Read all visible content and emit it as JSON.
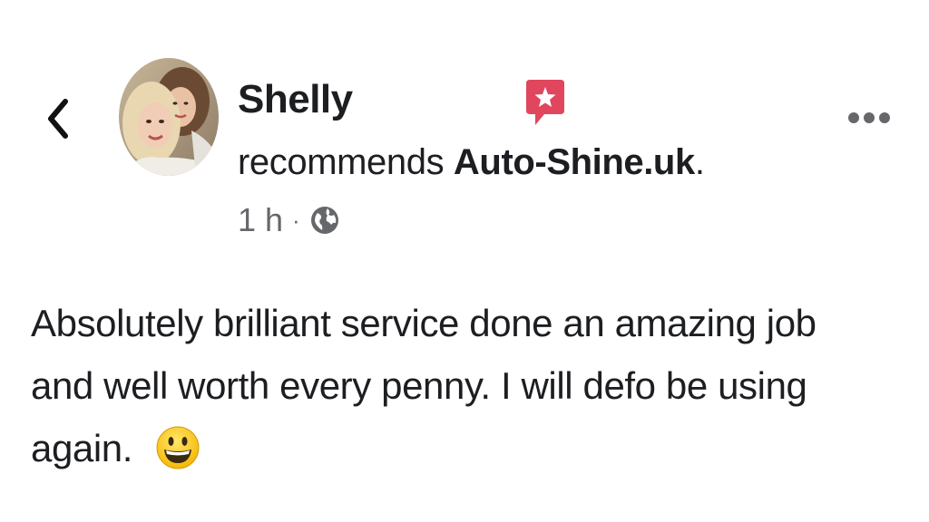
{
  "post": {
    "author": {
      "name": "Shelly",
      "avatar": "profile-photo"
    },
    "recommendation": {
      "verb": "recommends",
      "page": "Auto-Shine.uk",
      "punctuation": ".",
      "icon": "recommendation-star-icon",
      "icon_color": "#e0475e"
    },
    "meta": {
      "time": "1 h",
      "separator": "·",
      "audience_icon": "globe-icon"
    },
    "body": {
      "text": "Absolutely brilliant service done an amazing job and well worth every penny. I will defo be using again.",
      "emoji": "grinning-face-emoji"
    },
    "toolbar": {
      "back_icon": "chevron-left-icon",
      "more_icon": "more-options-icon"
    }
  }
}
